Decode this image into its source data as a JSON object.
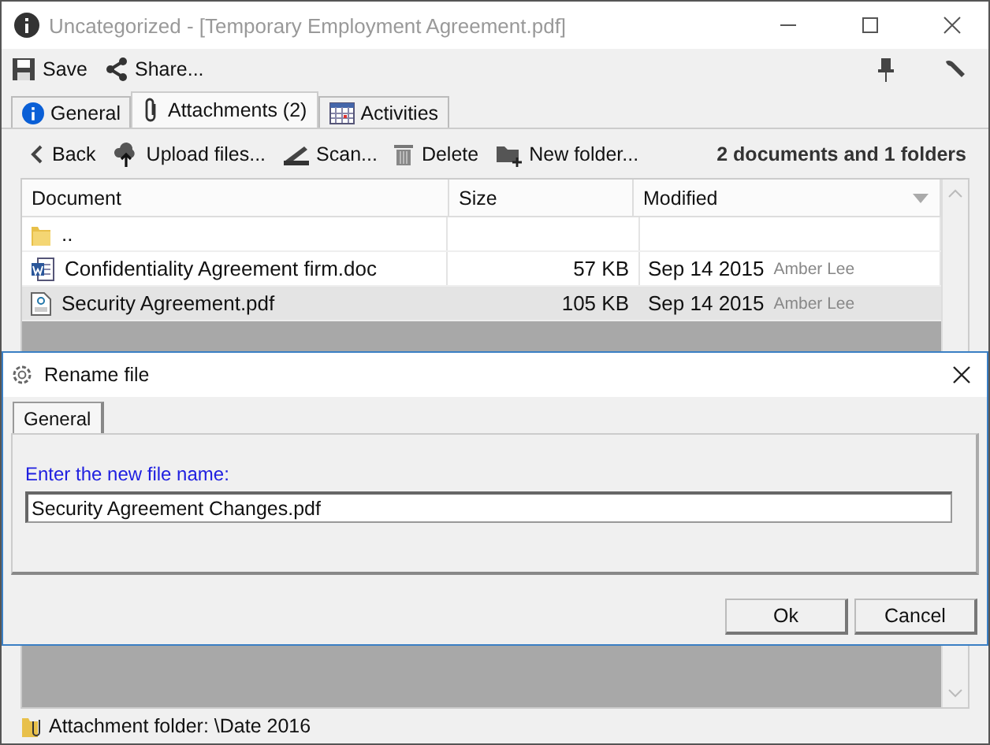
{
  "window": {
    "title": "Uncategorized - [Temporary Employment Agreement.pdf]"
  },
  "toolbar": [
    {
      "label": "Save",
      "kind": "save"
    },
    {
      "label": "Share...",
      "kind": "share"
    }
  ],
  "tabs": [
    {
      "label": "General",
      "selected": false,
      "kind": "info"
    },
    {
      "label": "Attachments (2)",
      "selected": true,
      "kind": "clip"
    },
    {
      "label": "Activities",
      "selected": false,
      "kind": "calendar"
    }
  ],
  "actions": [
    {
      "label": "Back",
      "kind": "back"
    },
    {
      "label": "Upload files...",
      "kind": "upload"
    },
    {
      "label": "Scan...",
      "kind": "scan"
    },
    {
      "label": "Delete",
      "kind": "delete"
    },
    {
      "label": "New folder...",
      "kind": "folder"
    }
  ],
  "summary": "2 documents and 1 folders",
  "table": {
    "columns": [
      "Document",
      "Size",
      "Modified"
    ],
    "rows": [
      {
        "kind": "folder",
        "name": "..",
        "selected": false
      },
      {
        "kind": "doc",
        "name": "Confidentiality Agreement firm.doc",
        "size": "57 KB",
        "modified": "Sep 14 2015",
        "author": "Amber Lee",
        "selected": false
      },
      {
        "kind": "pdf",
        "name": "Security Agreement.pdf",
        "size": "105 KB",
        "modified": "Sep 14 2015",
        "author": "Amber Lee",
        "selected": true
      }
    ]
  },
  "status_bar": "Attachment folder: \\Date 2016",
  "dialog": {
    "title": "Rename file",
    "tabs": [
      {
        "label": "General",
        "selected": true
      }
    ],
    "prompt": "Enter the new file name:",
    "value": "Security Agreement Changes.pdf",
    "buttons": [
      "Ok",
      "Cancel"
    ]
  }
}
